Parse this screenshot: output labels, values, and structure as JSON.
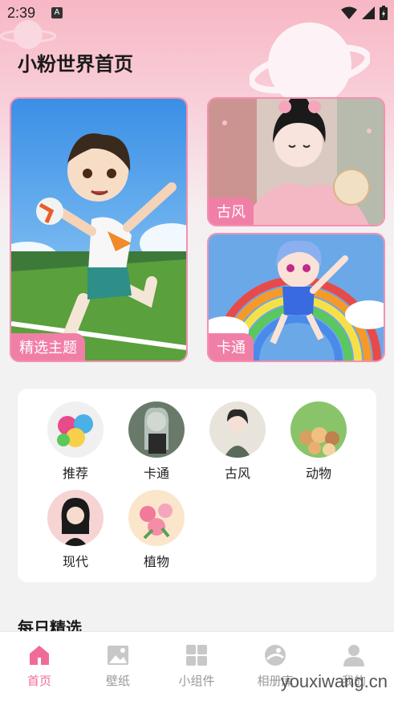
{
  "status_bar": {
    "time": "2:39",
    "notif_letter": "A"
  },
  "page_title": "小粉世界首页",
  "cards": {
    "featured": "精选主题",
    "ancient": "古风",
    "cartoon": "卡通"
  },
  "categories": [
    {
      "label": "推荐"
    },
    {
      "label": "卡通"
    },
    {
      "label": "古风"
    },
    {
      "label": "动物"
    },
    {
      "label": "现代"
    },
    {
      "label": "植物"
    }
  ],
  "section_title": "每日精选",
  "nav": {
    "items": [
      {
        "label": "首页",
        "icon": "home-icon",
        "active": true
      },
      {
        "label": "壁纸",
        "icon": "image-icon"
      },
      {
        "label": "小组件",
        "icon": "grid-icon"
      },
      {
        "label": "相册库",
        "icon": "album-icon"
      },
      {
        "label": "我的",
        "icon": "user-icon"
      }
    ]
  },
  "watermark": "youxiwang.cn",
  "colors": {
    "accent": "#f06c98",
    "tag_bg": "#f07fa7",
    "card_border": "#f58fb0"
  }
}
